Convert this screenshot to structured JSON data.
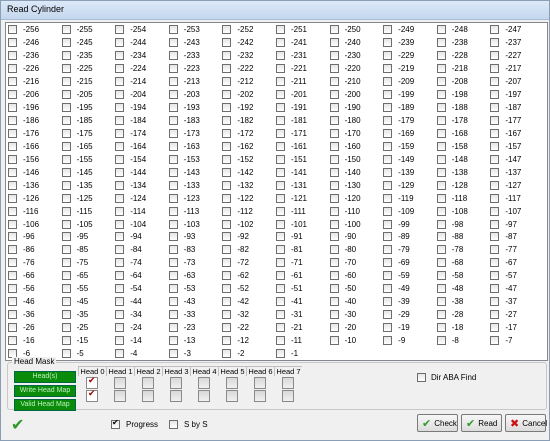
{
  "window": {
    "title": "Read Cylinder"
  },
  "cylinders": [
    "-256",
    "-255",
    "-254",
    "-253",
    "-252",
    "-251",
    "-250",
    "-249",
    "-248",
    "-247",
    "-246",
    "-245",
    "-244",
    "-243",
    "-242",
    "-241",
    "-240",
    "-239",
    "-238",
    "-237",
    "-236",
    "-235",
    "-234",
    "-233",
    "-232",
    "-231",
    "-230",
    "-229",
    "-228",
    "-227",
    "-226",
    "-225",
    "-224",
    "-223",
    "-222",
    "-221",
    "-220",
    "-219",
    "-218",
    "-217",
    "-216",
    "-215",
    "-214",
    "-213",
    "-212",
    "-211",
    "-210",
    "-209",
    "-208",
    "-207",
    "-206",
    "-205",
    "-204",
    "-203",
    "-202",
    "-201",
    "-200",
    "-199",
    "-198",
    "-197",
    "-196",
    "-195",
    "-194",
    "-193",
    "-192",
    "-191",
    "-190",
    "-189",
    "-188",
    "-187",
    "-186",
    "-185",
    "-184",
    "-183",
    "-182",
    "-181",
    "-180",
    "-179",
    "-178",
    "-177",
    "-176",
    "-175",
    "-174",
    "-173",
    "-172",
    "-171",
    "-170",
    "-169",
    "-168",
    "-167",
    "-166",
    "-165",
    "-164",
    "-163",
    "-162",
    "-161",
    "-160",
    "-159",
    "-158",
    "-157",
    "-156",
    "-155",
    "-154",
    "-153",
    "-152",
    "-151",
    "-150",
    "-149",
    "-148",
    "-147",
    "-146",
    "-145",
    "-144",
    "-143",
    "-142",
    "-141",
    "-140",
    "-139",
    "-138",
    "-137",
    "-136",
    "-135",
    "-134",
    "-133",
    "-132",
    "-131",
    "-130",
    "-129",
    "-128",
    "-127",
    "-126",
    "-125",
    "-124",
    "-123",
    "-122",
    "-121",
    "-120",
    "-119",
    "-118",
    "-117",
    "-116",
    "-115",
    "-114",
    "-113",
    "-112",
    "-111",
    "-110",
    "-109",
    "-108",
    "-107",
    "-106",
    "-105",
    "-104",
    "-103",
    "-102",
    "-101",
    "-100",
    "-99",
    "-98",
    "-97",
    "-96",
    "-95",
    "-94",
    "-93",
    "-92",
    "-91",
    "-90",
    "-89",
    "-88",
    "-87",
    "-86",
    "-85",
    "-84",
    "-83",
    "-82",
    "-81",
    "-80",
    "-79",
    "-78",
    "-77",
    "-76",
    "-75",
    "-74",
    "-73",
    "-72",
    "-71",
    "-70",
    "-69",
    "-68",
    "-67",
    "-66",
    "-65",
    "-64",
    "-63",
    "-62",
    "-61",
    "-60",
    "-59",
    "-58",
    "-57",
    "-56",
    "-55",
    "-54",
    "-53",
    "-52",
    "-51",
    "-50",
    "-49",
    "-48",
    "-47",
    "-46",
    "-45",
    "-44",
    "-43",
    "-42",
    "-41",
    "-40",
    "-39",
    "-38",
    "-37",
    "-36",
    "-35",
    "-34",
    "-33",
    "-32",
    "-31",
    "-30",
    "-29",
    "-28",
    "-27",
    "-26",
    "-25",
    "-24",
    "-23",
    "-22",
    "-21",
    "-20",
    "-19",
    "-18",
    "-17",
    "-16",
    "-15",
    "-14",
    "-13",
    "-12",
    "-11",
    "-10",
    "-9",
    "-8",
    "-7",
    "-6",
    "-5",
    "-4",
    "-3",
    "-2",
    "-1"
  ],
  "head_mask": {
    "title": "Head Mask",
    "row_labels": [
      "Head(s)",
      "Write Head Map",
      "Valid Head Map"
    ],
    "heads": [
      {
        "label": "Head 0",
        "write": true,
        "valid": true
      },
      {
        "label": "Head 1",
        "write": false,
        "valid": false
      },
      {
        "label": "Head 2",
        "write": false,
        "valid": false
      },
      {
        "label": "Head 3",
        "write": false,
        "valid": false
      },
      {
        "label": "Head 4",
        "write": false,
        "valid": false
      },
      {
        "label": "Head 5",
        "write": false,
        "valid": false
      },
      {
        "label": "Head 6",
        "write": false,
        "valid": false
      },
      {
        "label": "Head 7",
        "write": false,
        "valid": false
      }
    ],
    "dir_aba_find": {
      "label": "Dir ABA Find",
      "checked": false
    }
  },
  "options": {
    "progress": {
      "label": "Progress",
      "checked": true
    },
    "s_by_s": {
      "label": "S by S",
      "checked": false
    }
  },
  "buttons": {
    "check": {
      "label": "Check",
      "icon": "check-icon"
    },
    "read": {
      "label": "Read",
      "icon": "check-icon"
    },
    "cancel": {
      "label": "Cancel",
      "icon": "x-icon"
    }
  },
  "colors": {
    "green_label": "#0a8c0a",
    "check_green": "#2d9a2d",
    "cancel_red": "#cc1111"
  }
}
